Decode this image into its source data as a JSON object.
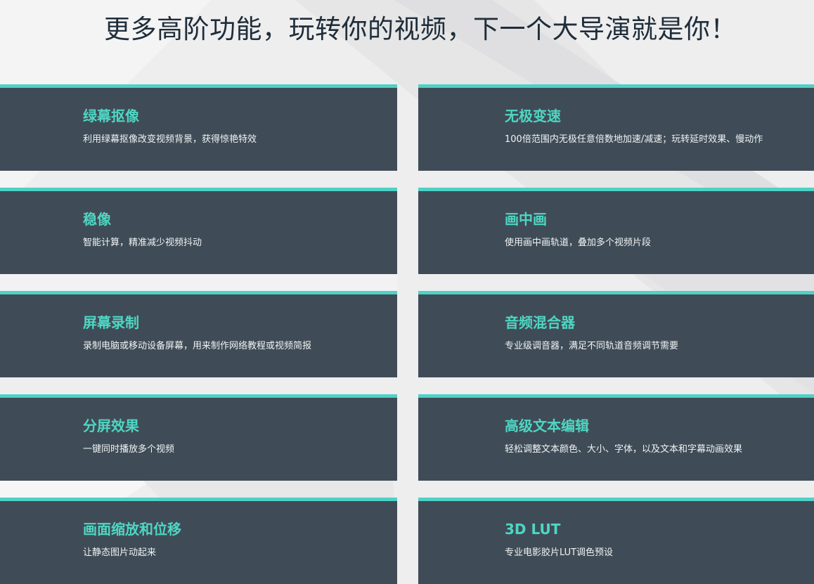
{
  "header": {
    "title": "更多高阶功能，玩转你的视频，下一个大导演就是你！"
  },
  "features": [
    {
      "title": "绿幕抠像",
      "desc": "利用绿幕抠像改变视频背景，获得惊艳特效"
    },
    {
      "title": "无极变速",
      "desc": "100倍范围内无极任意倍数地加速/减速；玩转延时效果、慢动作"
    },
    {
      "title": "稳像",
      "desc": "智能计算，精准减少视频抖动"
    },
    {
      "title": "画中画",
      "desc": "使用画中画轨道，叠加多个视频片段"
    },
    {
      "title": "屏幕录制",
      "desc": "录制电脑或移动设备屏幕，用来制作网络教程或视频简报"
    },
    {
      "title": "音频混合器",
      "desc": "专业级调音器，满足不同轨道音频调节需要"
    },
    {
      "title": "分屏效果",
      "desc": "一键同时播放多个视频"
    },
    {
      "title": "高级文本编辑",
      "desc": "轻松调整文本颜色、大小、字体，以及文本和字幕动画效果"
    },
    {
      "title": "画面缩放和位移",
      "desc": "让静态图片动起来"
    },
    {
      "title": "3D LUT",
      "desc": "专业电影胶片LUT调色预设"
    }
  ],
  "colors": {
    "card_background": "#3f4c57",
    "accent": "#4fd1c5",
    "page_background": "#eeeeef",
    "title_text": "#1f2d3a"
  }
}
